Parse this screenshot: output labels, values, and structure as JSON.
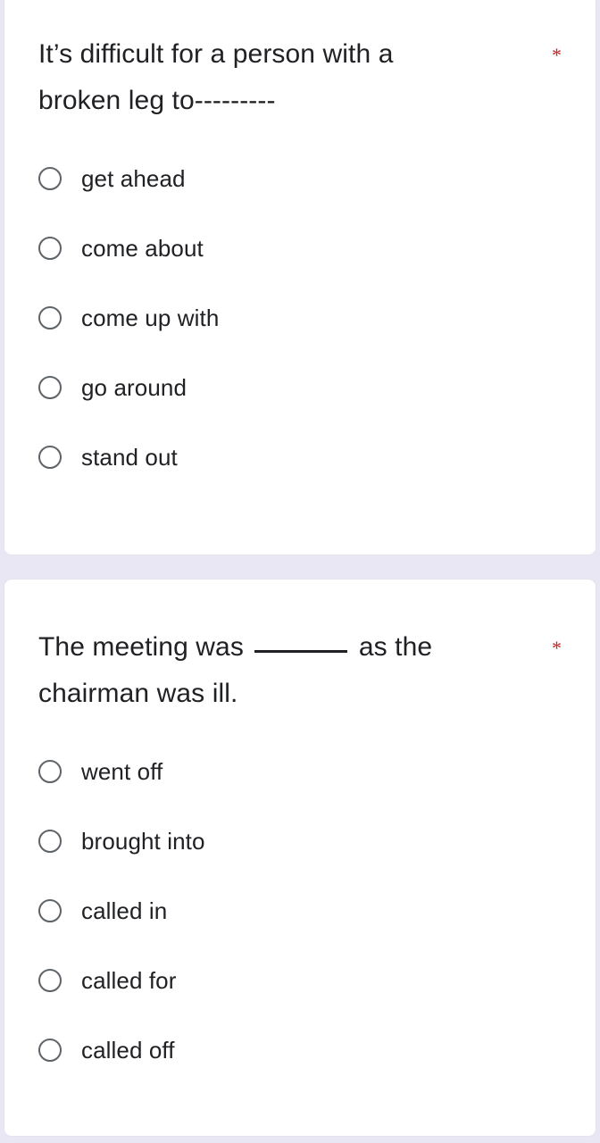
{
  "theme": {
    "page_background": "#eae7f5",
    "card_background": "#ffffff",
    "text_color": "#202124",
    "required_marker_color": "#c5221f",
    "radio_outline_color": "#5f6368"
  },
  "questions": [
    {
      "id": "question-1",
      "title_line_1": "It’s difficult for a person with a",
      "title_line_2": "broken leg to---------",
      "required_marker": "*",
      "blank_style": "dashes",
      "options": [
        {
          "label": "get ahead",
          "selected": false
        },
        {
          "label": "come about",
          "selected": false
        },
        {
          "label": "come up with",
          "selected": false
        },
        {
          "label": "go around",
          "selected": false
        },
        {
          "label": "stand out",
          "selected": false
        }
      ]
    },
    {
      "id": "question-2",
      "title_before_blank": "The meeting was ",
      "title_after_blank": " as the",
      "title_line_2": "chairman was ill.",
      "required_marker": "*",
      "blank_style": "underline",
      "options": [
        {
          "label": "went off",
          "selected": false
        },
        {
          "label": "brought into",
          "selected": false
        },
        {
          "label": "called in",
          "selected": false
        },
        {
          "label": "called for",
          "selected": false
        },
        {
          "label": "called off",
          "selected": false
        }
      ]
    }
  ]
}
